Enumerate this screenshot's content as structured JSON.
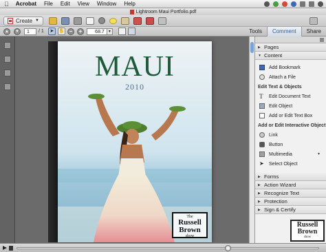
{
  "menubar": {
    "items": [
      "Acrobat",
      "File",
      "Edit",
      "View",
      "Window",
      "Help"
    ]
  },
  "window": {
    "title": "Lightroom Maui Portfolio.pdf"
  },
  "toolbar": {
    "create_label": "Create"
  },
  "navigation": {
    "page_number": "1",
    "page_total": "/ 1",
    "zoom": "68.7"
  },
  "task_tabs": [
    "Tools",
    "Comment",
    "Share"
  ],
  "document": {
    "title": "MAUI",
    "year": "2010",
    "logo": {
      "line1": "The",
      "line2": "Russell",
      "line3": "Brown",
      "line4": "show"
    }
  },
  "panel": {
    "sections_top": [
      {
        "label": "Pages",
        "expanded": false
      },
      {
        "label": "Content",
        "expanded": true
      }
    ],
    "content_items_a": [
      "Add Bookmark",
      "Attach a File"
    ],
    "group1": "Edit Text & Objects",
    "content_items_b": [
      "Edit Document Text",
      "Edit Object",
      "Add or Edit Text Box"
    ],
    "group2": "Add or Edit Interactive Object",
    "content_items_c": [
      "Link",
      "Button",
      "Multimedia",
      "Select Object"
    ],
    "sections_bottom": [
      {
        "label": "Forms"
      },
      {
        "label": "Action Wizard"
      },
      {
        "label": "Recognize Text"
      },
      {
        "label": "Protection"
      },
      {
        "label": "Sign & Certify"
      }
    ]
  },
  "media": {
    "progress": 0.7
  },
  "colors": {
    "title_green": "#1f5a3a",
    "year_blue": "#4d6f8e",
    "active_tab_blue": "#2d5b9a"
  }
}
